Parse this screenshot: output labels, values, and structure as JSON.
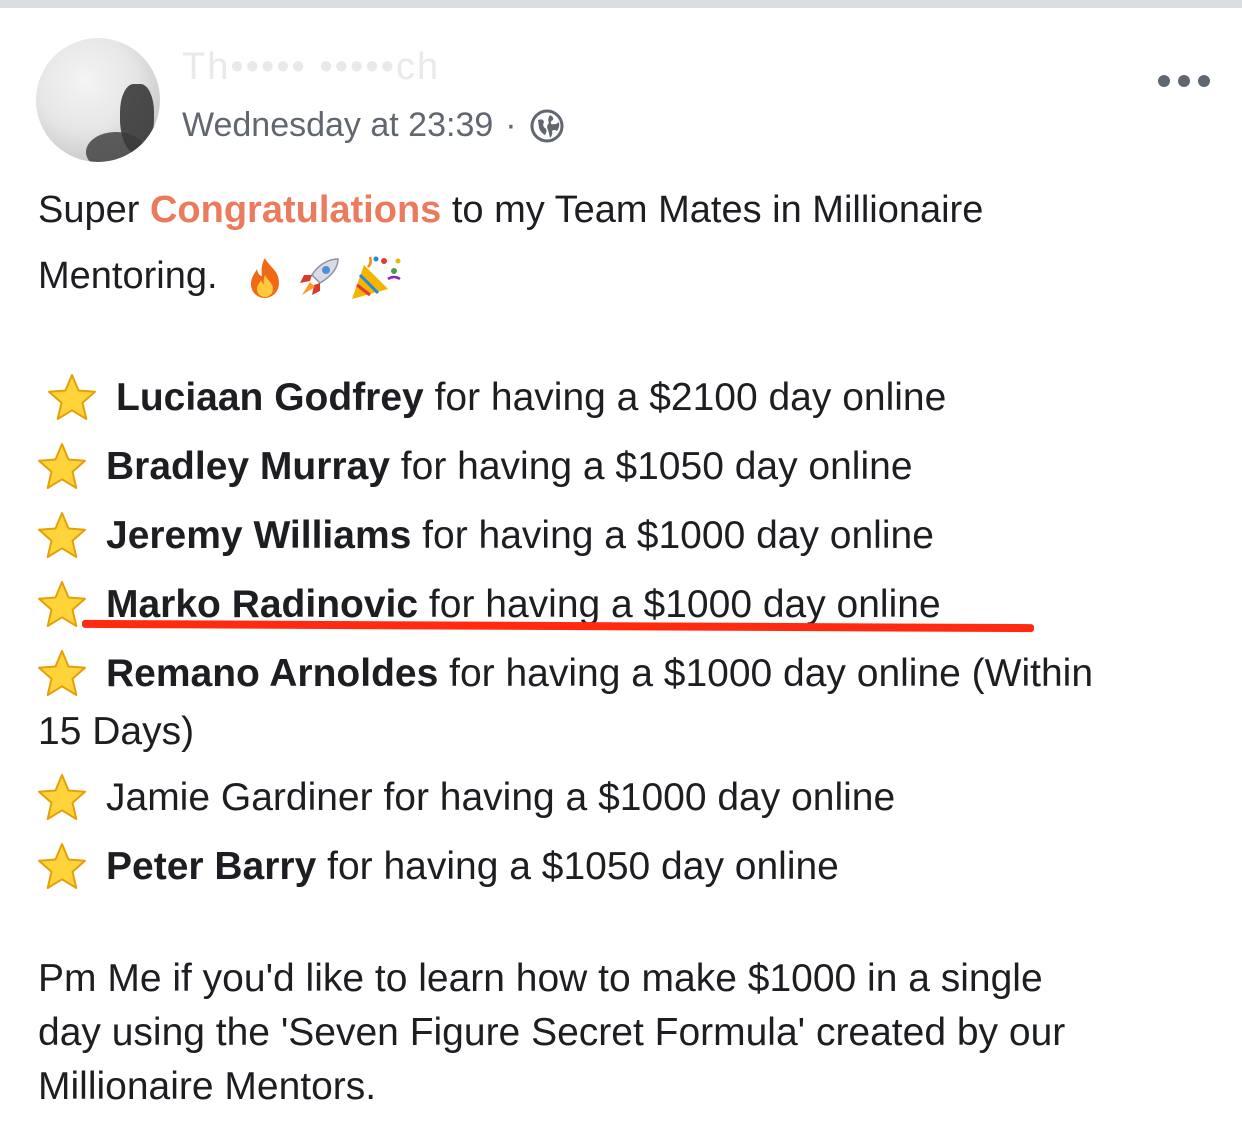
{
  "post": {
    "author_name": "Th••••• •••••ch",
    "timestamp": "Wednesday at 23:39",
    "separator": "·",
    "audience_icon": "globe-icon",
    "menu_icon": "more-options-icon"
  },
  "body": {
    "intro_prefix": "Super",
    "intro_highlight": "Congratulations",
    "intro_suffix": "to my Team Mates in Millionaire",
    "intro_line2": "Mentoring.",
    "intro_emojis": [
      "fire-icon",
      "rocket-icon",
      "party-popper-icon"
    ],
    "accent_color": "#ec7a5c"
  },
  "achievements": [
    {
      "name": "Luciaan Godfrey",
      "text": "for having a $2100 day online",
      "bold": true
    },
    {
      "name": "Bradley Murray",
      "text": "for having a $1050 day online",
      "bold": true
    },
    {
      "name": "Jeremy Williams",
      "text": "for having a $1000 day online",
      "bold": true
    },
    {
      "name": "Marko Radinovic",
      "text": "for having a $1000 day online",
      "bold": true,
      "underlined": true
    },
    {
      "name": "Remano Arnoldes",
      "text": "for having a $1000 day online (Within",
      "continuation": "15 Days)",
      "bold": true
    },
    {
      "name": "Jamie Gardiner",
      "text": "for having a $1000 day online",
      "bold": false
    },
    {
      "name": "Peter Barry",
      "text": "for having a $1050 day online",
      "bold": true
    }
  ],
  "underline_color": "#ff2a10",
  "closing": {
    "line1": "Pm Me if you'd like to learn how to make $1000 in a single",
    "line2": "day using the 'Seven Figure Secret Formula' created by our",
    "line3": "Millionaire Mentors."
  }
}
